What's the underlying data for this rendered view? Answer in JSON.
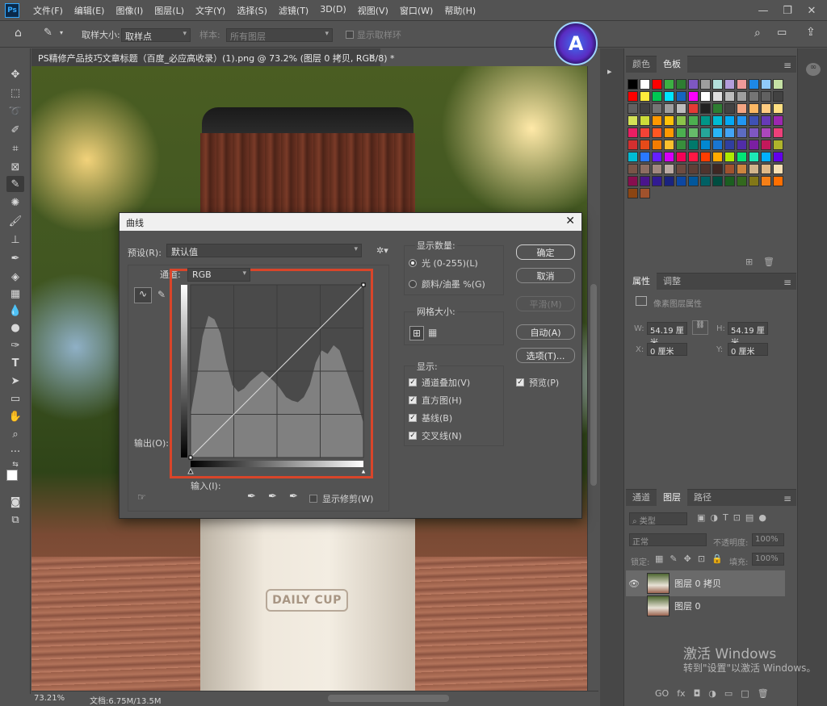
{
  "app": {
    "logo": "Ps"
  },
  "menu": [
    "文件(F)",
    "编辑(E)",
    "图像(I)",
    "图层(L)",
    "文字(Y)",
    "选择(S)",
    "滤镜(T)",
    "3D(D)",
    "视图(V)",
    "窗口(W)",
    "帮助(H)"
  ],
  "window_controls": [
    "—",
    "❐",
    "✕"
  ],
  "options": {
    "sample_size_label": "取样大小:",
    "sample_size_value": "取样点",
    "sample_label": "样本:",
    "sample_value": "所有图层",
    "show_ring_label": "显示取样环"
  },
  "document": {
    "tab_title": "PS精修产品技巧文章标题（百度_必应高收录）(1).png @ 73.2% (图层 0 拷贝, RGB/8) *",
    "close": "×",
    "product_label": "DAILY CUP",
    "zoom": "73.21%",
    "doc_size": "文档:6.75M/13.5M"
  },
  "panels": {
    "color_tabs": [
      "颜色",
      "色板"
    ],
    "swatch_colors": [
      "#000000",
      "#ffffff",
      "#ff0000",
      "#3cb043",
      "#2e7d32",
      "#7e57c2",
      "#9e9e9e",
      "#b2dfdb",
      "#b39ddb",
      "#ef9a9a",
      "#1e88e5",
      "#90caf9",
      "#c5e1a5",
      "#ff0000",
      "#ffeb3b",
      "#00c853",
      "#00e5ff",
      "#1565c0",
      "#ff00ff",
      "#ffffff",
      "#e0e0e0",
      "#bdbdbd",
      "#9e9e9e",
      "#757575",
      "#616161",
      "#424242",
      "#616161",
      "#424242",
      "#757575",
      "#9e9e9e",
      "#bdbdbd",
      "#e53935",
      "#212121",
      "#2e7d32",
      "#424242",
      "#f4a582",
      "#fdb863",
      "#ffcc80",
      "#ffe082",
      "#d4e157",
      "#cddc39",
      "#ff9800",
      "#ffc107",
      "#8bc34a",
      "#4caf50",
      "#009688",
      "#00bcd4",
      "#03a9f4",
      "#2196f3",
      "#3f51b5",
      "#673ab7",
      "#9c27b0",
      "#e91e63",
      "#f44336",
      "#ff5722",
      "#ff9800",
      "#4caf50",
      "#66bb6a",
      "#26a69a",
      "#29b6f6",
      "#42a5f5",
      "#5c6bc0",
      "#7e57c2",
      "#ab47bc",
      "#ec407a",
      "#d32f2f",
      "#e64a19",
      "#f57c00",
      "#fbc02d",
      "#388e3c",
      "#00796b",
      "#0288d1",
      "#1976d2",
      "#303f9f",
      "#512da8",
      "#7b1fa2",
      "#c2185b",
      "#afb42b",
      "#00bcd4",
      "#2979ff",
      "#651fff",
      "#d500f9",
      "#f50057",
      "#ff1744",
      "#ff3d00",
      "#ffab00",
      "#aeea00",
      "#00e676",
      "#1de9b6",
      "#00b0ff",
      "#6200ea",
      "#795548",
      "#8d6e63",
      "#a1887f",
      "#bcaaa4",
      "#6d4c41",
      "#5d4037",
      "#4e342e",
      "#3e2723",
      "#a0522d",
      "#cd853f",
      "#d2b48c",
      "#deb887",
      "#f5deb3",
      "#880e4f",
      "#4a148c",
      "#311b92",
      "#1a237e",
      "#0d47a1",
      "#01579b",
      "#006064",
      "#004d40",
      "#1b5e20",
      "#33691e",
      "#827717",
      "#f57f17",
      "#ff6f00",
      "#8b4513",
      "#a0522d"
    ],
    "props_tabs": [
      "属性",
      "调整"
    ],
    "props_title": "像素图层属性",
    "props": {
      "w_label": "W:",
      "w": "54.19 厘米",
      "h_label": "H:",
      "h": "54.19 厘米",
      "x_label": "X:",
      "x": "0 厘米",
      "y_label": "Y:",
      "y": "0 厘米"
    },
    "layers_tabs": [
      "通道",
      "图层",
      "路径"
    ],
    "layer_filter": "类型",
    "blend_mode": "正常",
    "opacity_label": "不透明度:",
    "opacity": "100%",
    "lock_label": "锁定:",
    "fill_label": "填充:",
    "fill": "100%",
    "layers": [
      {
        "name": "图层 0 拷贝",
        "visible": true,
        "selected": true
      },
      {
        "name": "图层 0",
        "visible": false,
        "selected": false
      }
    ],
    "layer_footer_icons": [
      "GO",
      "fx",
      "◘",
      "◑",
      "▭",
      "□",
      "🗑"
    ]
  },
  "dialog": {
    "title": "曲线",
    "preset_label": "预设(R):",
    "preset_value": "默认值",
    "channel_label": "通道:",
    "channel_value": "RGB",
    "output_label": "输出(O):",
    "input_label": "输入(I):",
    "show_clipping_label": "显示修剪(W)",
    "display_amount_title": "显示数量:",
    "light_label": "光 (0-255)(L)",
    "pigment_label": "颜料/油墨 %(G)",
    "grid_size_title": "网格大小:",
    "show_title": "显示:",
    "checks": [
      "通道叠加(V)",
      "直方图(H)",
      "基线(B)",
      "交叉线(N)"
    ],
    "preview_label": "预览(P)",
    "buttons": {
      "ok": "确定",
      "cancel": "取消",
      "smooth": "平滑(M)",
      "auto": "自动(A)",
      "options": "选项(T)..."
    }
  },
  "watermark": {
    "line1": "激活 Windows",
    "line2": "转到\"设置\"以激活 Windows。"
  }
}
